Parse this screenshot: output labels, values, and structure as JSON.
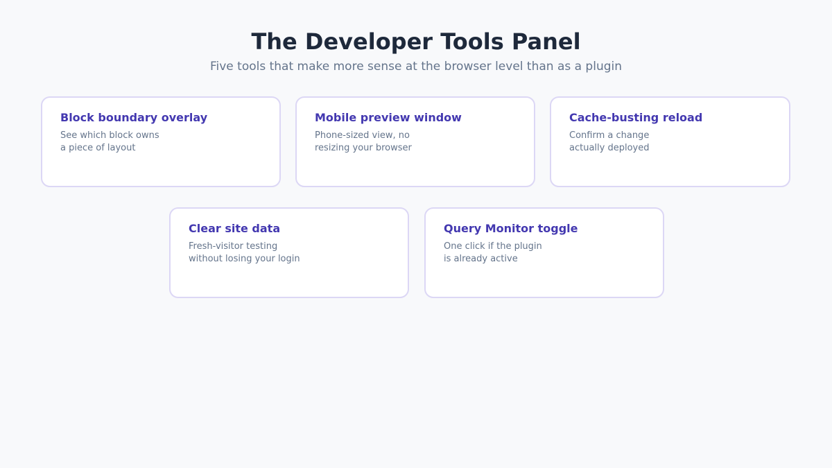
{
  "header": {
    "title": "The Developer Tools Panel",
    "subtitle": "Five tools that make more sense at the browser level than as a plugin"
  },
  "cards": [
    {
      "title": "Block boundary overlay",
      "lines": [
        "See which block owns",
        "a piece of layout"
      ]
    },
    {
      "title": "Mobile preview window",
      "lines": [
        "Phone-sized view, no",
        "resizing your browser"
      ]
    },
    {
      "title": "Cache-busting reload",
      "lines": [
        "Confirm a change",
        "actually deployed"
      ]
    },
    {
      "title": "Clear site data",
      "lines": [
        "Fresh-visitor testing",
        "without losing your login"
      ]
    },
    {
      "title": "Query Monitor toggle",
      "lines": [
        "One click if the plugin",
        "is already active"
      ]
    }
  ],
  "colors": {
    "background": "#f8f9fb",
    "title": "#1e293b",
    "subtitle": "#64748b",
    "card_title": "#4338b0",
    "card_border": "#dcd7f5"
  }
}
